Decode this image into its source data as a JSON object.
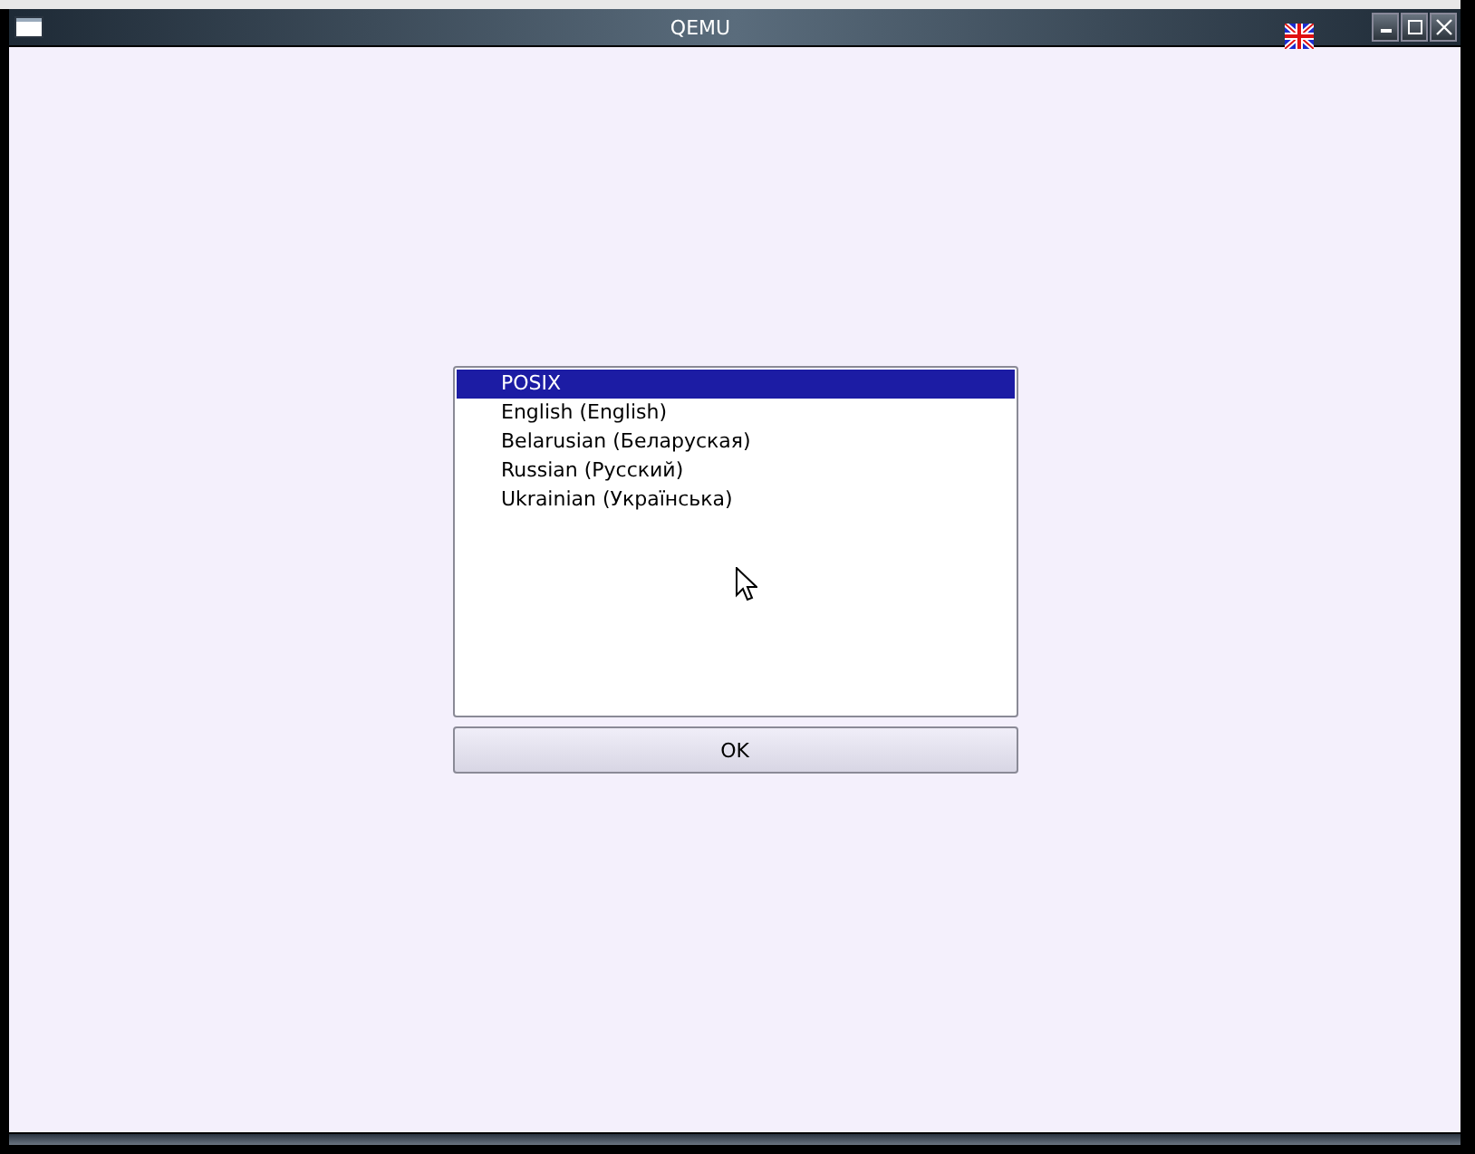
{
  "window": {
    "title": "QEMU"
  },
  "languages": [
    {
      "label": "POSIX",
      "selected": true
    },
    {
      "label": "English (English)",
      "selected": false
    },
    {
      "label": "Belarusian (Беларуская)",
      "selected": false
    },
    {
      "label": "Russian (Русский)",
      "selected": false
    },
    {
      "label": "Ukrainian (Українська)",
      "selected": false
    }
  ],
  "ok_button": "OK"
}
